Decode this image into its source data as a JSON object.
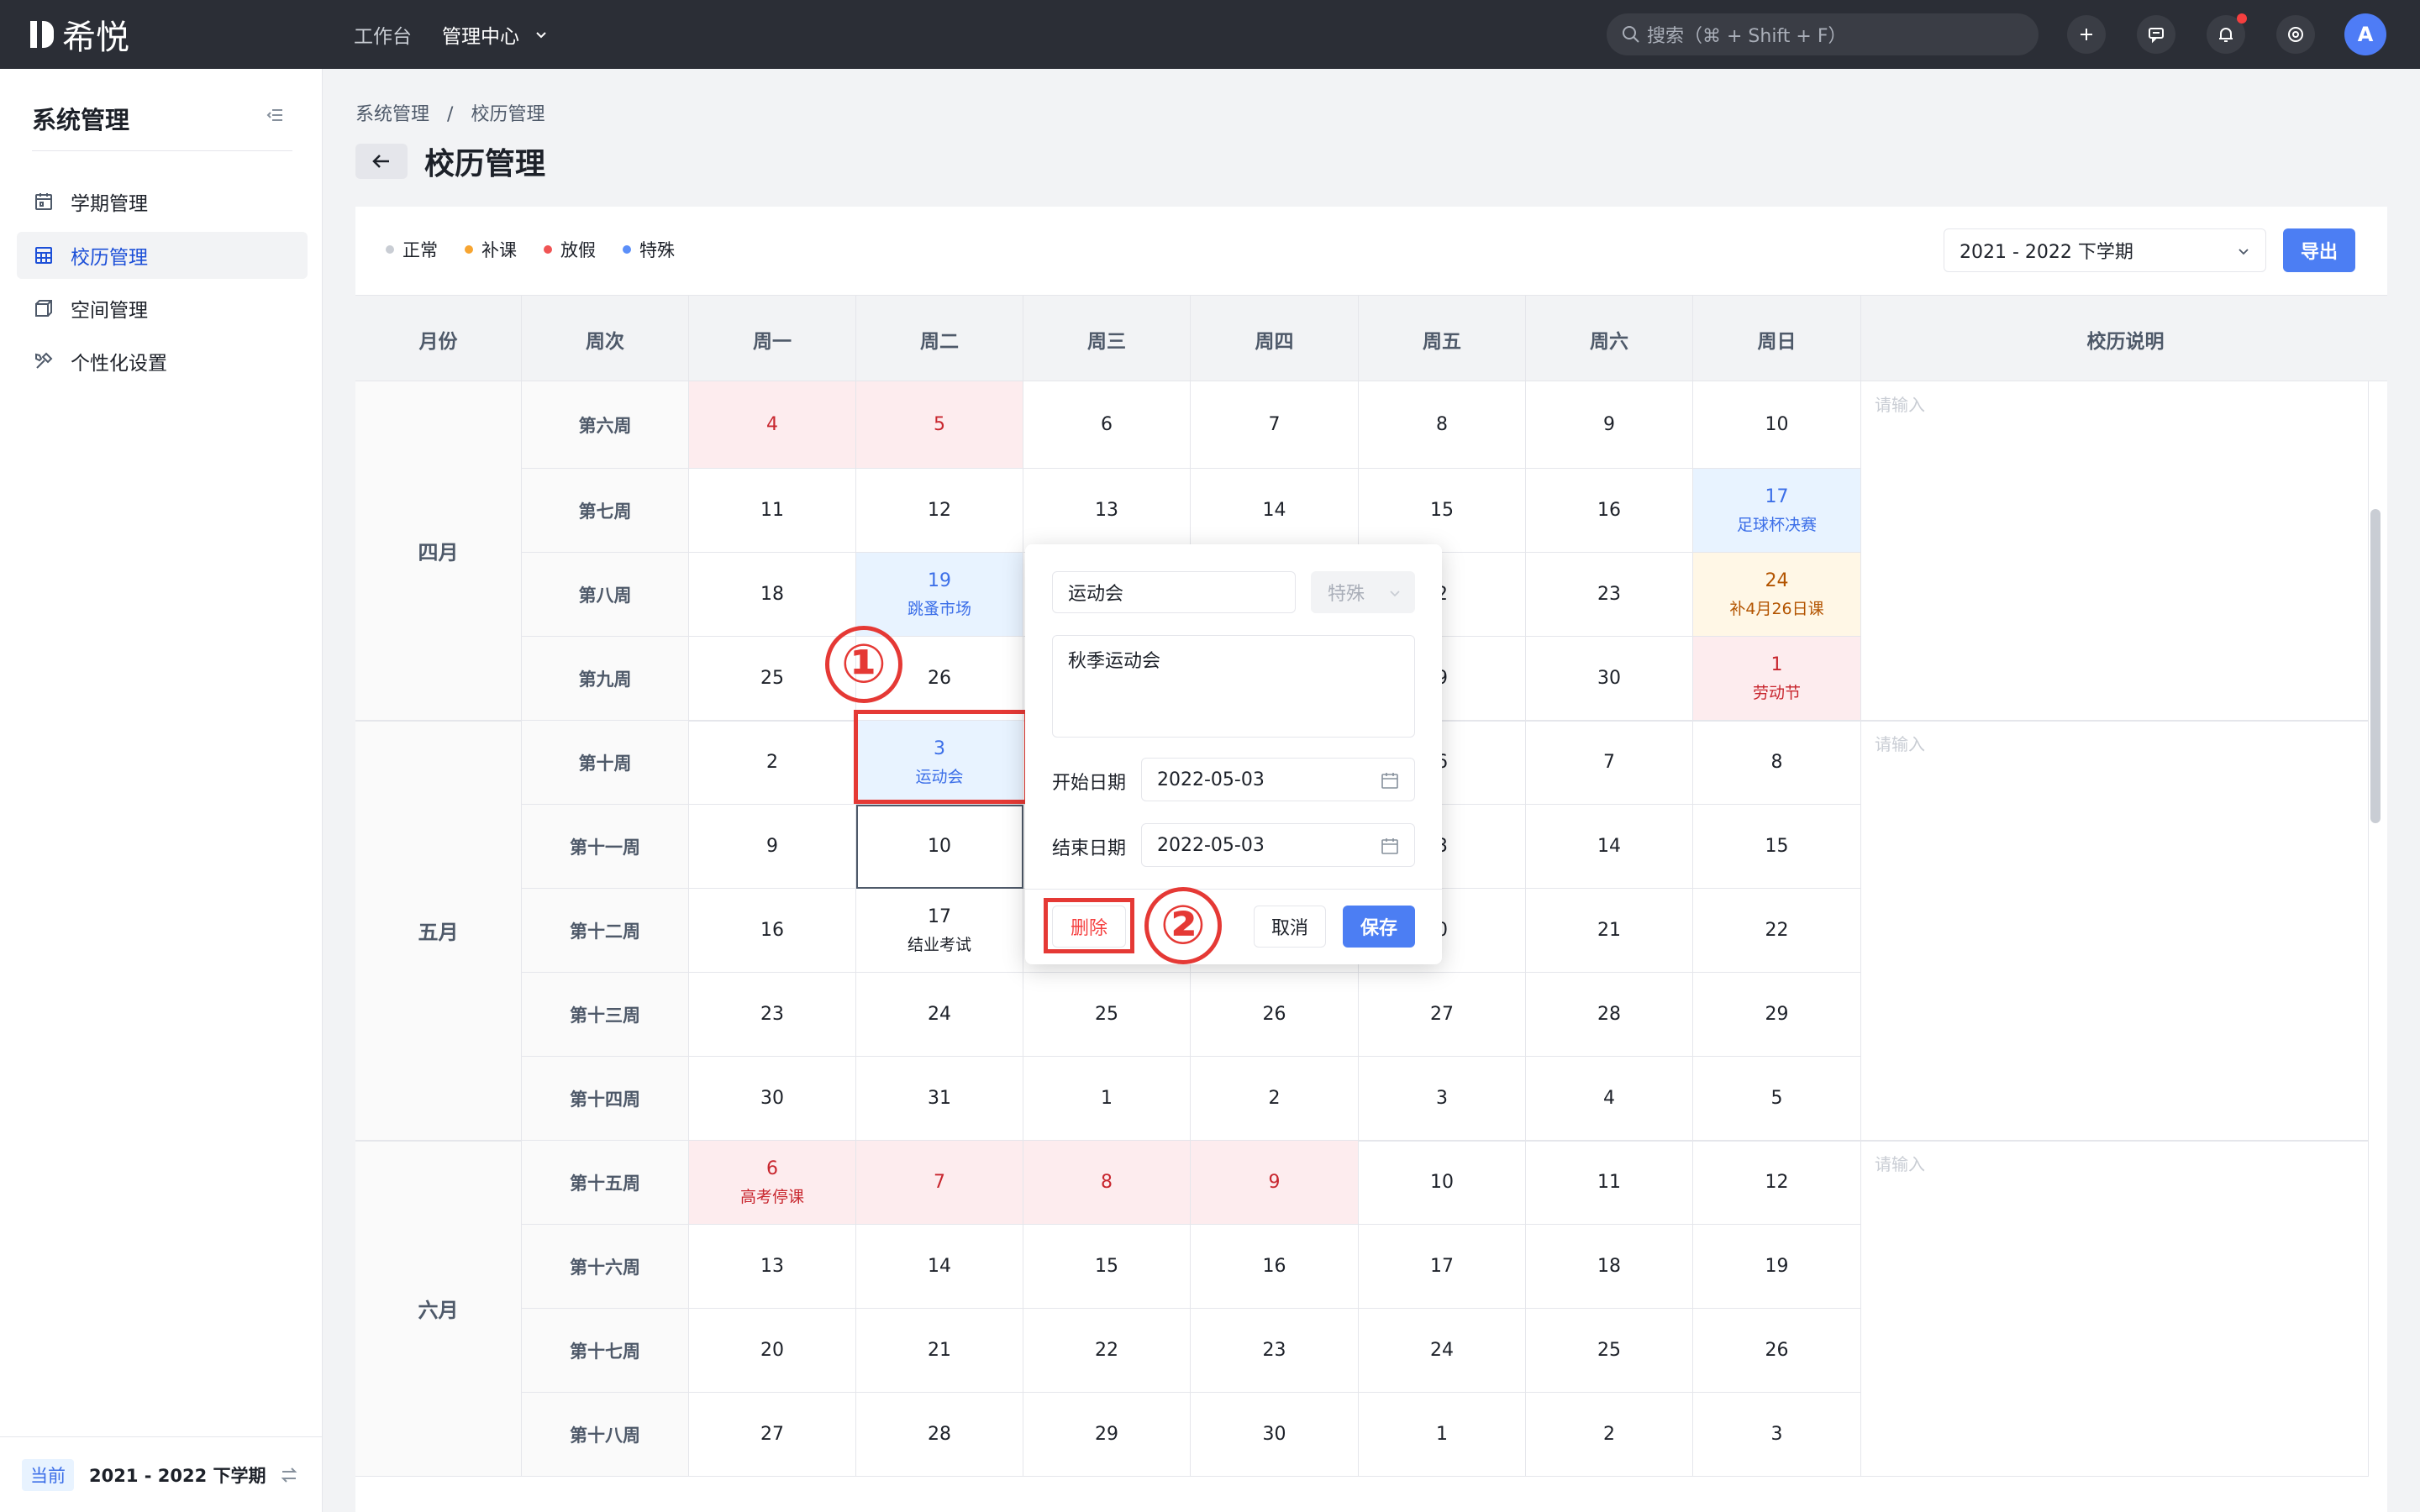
{
  "topbar": {
    "logo_text": "希悦",
    "nav": [
      {
        "label": "工作台",
        "active": false
      },
      {
        "label": "管理中心",
        "active": true
      }
    ],
    "search_placeholder": "搜索（⌘ + Shift + F）",
    "avatar_letter": "A",
    "icons": [
      "plus-icon",
      "message-icon",
      "bell-icon",
      "help-icon"
    ]
  },
  "sidebar": {
    "title": "系统管理",
    "items": [
      {
        "label": "学期管理",
        "icon": "calendar-icon",
        "active": false
      },
      {
        "label": "校历管理",
        "icon": "table-icon",
        "active": true
      },
      {
        "label": "空间管理",
        "icon": "cube-icon",
        "active": false
      },
      {
        "label": "个性化设置",
        "icon": "tools-icon",
        "active": false
      }
    ],
    "current_tag": "当前",
    "current_term": "2021 - 2022 下学期"
  },
  "breadcrumb": [
    "系统管理",
    "/",
    "校历管理"
  ],
  "page_title": "校历管理",
  "legend": [
    {
      "label": "正常",
      "color": "#c9cdd4"
    },
    {
      "label": "补课",
      "color": "#f7a531"
    },
    {
      "label": "放假",
      "color": "#f05454"
    },
    {
      "label": "特殊",
      "color": "#5b8ff9"
    }
  ],
  "term_select": {
    "value": "2021 - 2022 下学期"
  },
  "export_label": "导出",
  "table_headers": [
    "月份",
    "周次",
    "周一",
    "周二",
    "周三",
    "周四",
    "周五",
    "周六",
    "周日",
    "校历说明"
  ],
  "remark_placeholder": "请输入",
  "months": [
    {
      "label": "四月",
      "week_start": 0,
      "week_count": 4
    },
    {
      "label": "五月",
      "week_start": 4,
      "week_count": 5
    },
    {
      "label": "六月",
      "week_start": 9,
      "week_count": 4
    }
  ],
  "weeks": [
    {
      "label": "第六周",
      "days": [
        {
          "d": "4",
          "t": "holiday"
        },
        {
          "d": "5",
          "t": "holiday"
        },
        {
          "d": "6"
        },
        {
          "d": "7"
        },
        {
          "d": "8"
        },
        {
          "d": "9"
        },
        {
          "d": "10"
        }
      ]
    },
    {
      "label": "第七周",
      "days": [
        {
          "d": "11"
        },
        {
          "d": "12"
        },
        {
          "d": "13"
        },
        {
          "d": "14"
        },
        {
          "d": "15"
        },
        {
          "d": "16"
        },
        {
          "d": "17",
          "t": "special",
          "note": "足球杯决赛"
        }
      ]
    },
    {
      "label": "第八周",
      "days": [
        {
          "d": "18"
        },
        {
          "d": "19",
          "t": "special",
          "note": "跳蚤市场"
        },
        {
          "d": ""
        },
        {
          "d": ""
        },
        {
          "d": "2"
        },
        {
          "d": "23"
        },
        {
          "d": "24",
          "t": "makeup",
          "note": "补4月26日课"
        }
      ]
    },
    {
      "label": "第九周",
      "days": [
        {
          "d": "25"
        },
        {
          "d": "26"
        },
        {
          "d": ""
        },
        {
          "d": ""
        },
        {
          "d": "9"
        },
        {
          "d": "30"
        },
        {
          "d": "1",
          "t": "holiday",
          "note": "劳动节"
        }
      ]
    },
    {
      "label": "第十周",
      "days": [
        {
          "d": "2"
        },
        {
          "d": "3",
          "t": "special",
          "note": "运动会"
        },
        {
          "d": ""
        },
        {
          "d": ""
        },
        {
          "d": "6"
        },
        {
          "d": "7"
        },
        {
          "d": "8"
        }
      ]
    },
    {
      "label": "第十一周",
      "days": [
        {
          "d": "9"
        },
        {
          "d": "10",
          "t": "boxed"
        },
        {
          "d": ""
        },
        {
          "d": ""
        },
        {
          "d": "3"
        },
        {
          "d": "14"
        },
        {
          "d": "15"
        }
      ]
    },
    {
      "label": "第十二周",
      "days": [
        {
          "d": "16"
        },
        {
          "d": "17",
          "note": "结业考试"
        },
        {
          "d": ""
        },
        {
          "d": ""
        },
        {
          "d": "0"
        },
        {
          "d": "21"
        },
        {
          "d": "22"
        }
      ]
    },
    {
      "label": "第十三周",
      "days": [
        {
          "d": "23"
        },
        {
          "d": "24"
        },
        {
          "d": "25"
        },
        {
          "d": "26"
        },
        {
          "d": "27"
        },
        {
          "d": "28"
        },
        {
          "d": "29"
        }
      ]
    },
    {
      "label": "第十四周",
      "days": [
        {
          "d": "30"
        },
        {
          "d": "31"
        },
        {
          "d": "1"
        },
        {
          "d": "2"
        },
        {
          "d": "3"
        },
        {
          "d": "4"
        },
        {
          "d": "5"
        }
      ]
    },
    {
      "label": "第十五周",
      "days": [
        {
          "d": "6",
          "t": "holiday",
          "note": "高考停课"
        },
        {
          "d": "7",
          "t": "holiday"
        },
        {
          "d": "8",
          "t": "holiday"
        },
        {
          "d": "9",
          "t": "holiday"
        },
        {
          "d": "10"
        },
        {
          "d": "11"
        },
        {
          "d": "12"
        }
      ]
    },
    {
      "label": "第十六周",
      "days": [
        {
          "d": "13"
        },
        {
          "d": "14"
        },
        {
          "d": "15"
        },
        {
          "d": "16"
        },
        {
          "d": "17"
        },
        {
          "d": "18"
        },
        {
          "d": "19"
        }
      ]
    },
    {
      "label": "第十七周",
      "days": [
        {
          "d": "20"
        },
        {
          "d": "21"
        },
        {
          "d": "22"
        },
        {
          "d": "23"
        },
        {
          "d": "24"
        },
        {
          "d": "25"
        },
        {
          "d": "26"
        }
      ]
    },
    {
      "label": "第十八周",
      "days": [
        {
          "d": "27"
        },
        {
          "d": "28"
        },
        {
          "d": "29"
        },
        {
          "d": "30"
        },
        {
          "d": "1"
        },
        {
          "d": "2"
        },
        {
          "d": "3"
        }
      ]
    }
  ],
  "popover": {
    "event_name": "运动会",
    "type_value": "特殊",
    "description": "秋季运动会",
    "start_label": "开始日期",
    "start_date": "2022-05-03",
    "end_label": "结束日期",
    "end_date": "2022-05-03",
    "delete_label": "删除",
    "cancel_label": "取消",
    "save_label": "保存"
  },
  "annotations": {
    "step1": "①",
    "step2": "②",
    "color": "#e53935"
  }
}
